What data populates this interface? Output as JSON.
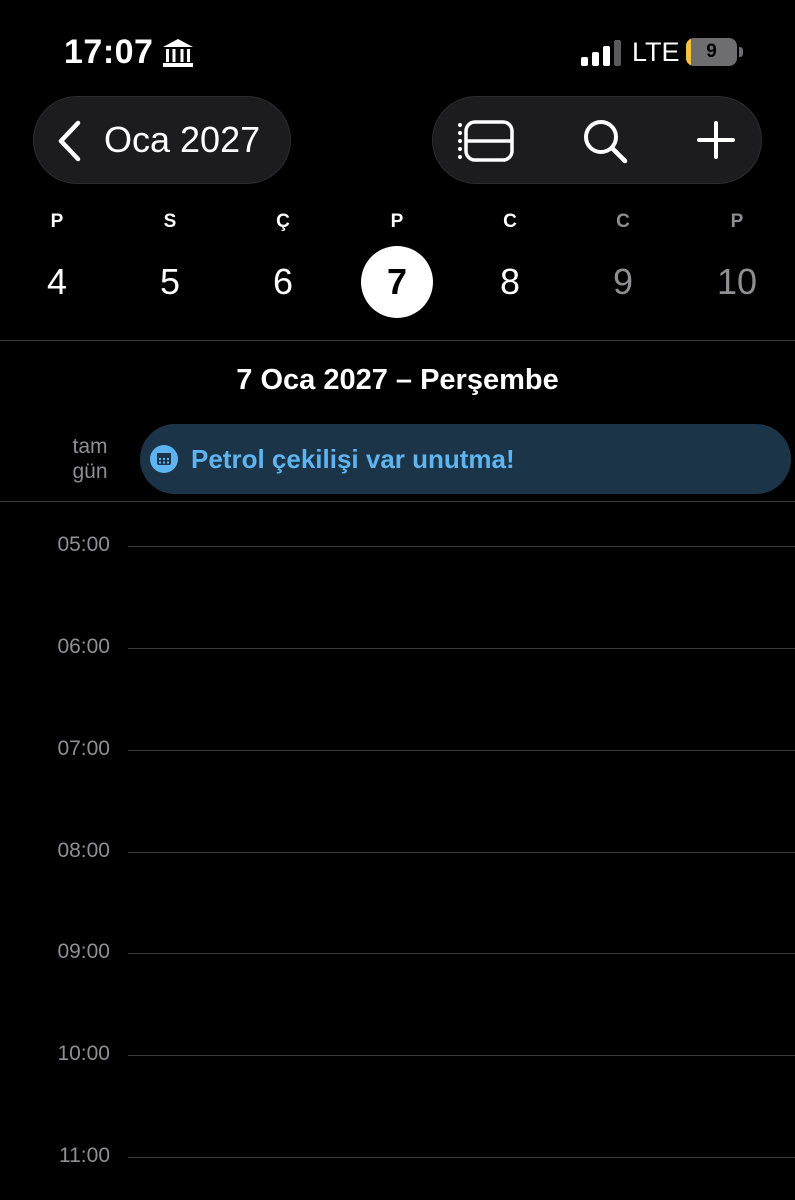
{
  "status_bar": {
    "time": "17:07",
    "network": "LTE",
    "battery_level": "9",
    "battery_fraction": 0.09,
    "signal_bars_active": 3,
    "icons": [
      "bank-icon",
      "cellular-signal-icon",
      "battery-icon"
    ]
  },
  "toolbar": {
    "back_label": "Oca 2027",
    "icons": [
      "chevron-left-icon",
      "list-view-icon",
      "search-icon",
      "add-icon"
    ]
  },
  "week": {
    "days": [
      {
        "weekday": "P",
        "number": "4",
        "selected": false,
        "dim": false
      },
      {
        "weekday": "S",
        "number": "5",
        "selected": false,
        "dim": false
      },
      {
        "weekday": "Ç",
        "number": "6",
        "selected": false,
        "dim": false
      },
      {
        "weekday": "P",
        "number": "7",
        "selected": true,
        "dim": false
      },
      {
        "weekday": "C",
        "number": "8",
        "selected": false,
        "dim": false
      },
      {
        "weekday": "C",
        "number": "9",
        "selected": false,
        "dim": true
      },
      {
        "weekday": "P",
        "number": "10",
        "selected": false,
        "dim": true
      }
    ]
  },
  "day_view": {
    "date_heading": "7 Oca 2027 – Perşembe",
    "all_day_label_line1": "tam",
    "all_day_label_line2": "gün",
    "all_day_event": {
      "title": "Petrol çekilişi var unutma!",
      "icon": "calendar-icon"
    },
    "hours": [
      "05:00",
      "06:00",
      "07:00",
      "08:00",
      "09:00",
      "10:00",
      "11:00"
    ]
  },
  "colors": {
    "background": "#000000",
    "pill": "#1c1c1e",
    "event_background": "#1b3447",
    "event_text": "#5eb4f0",
    "secondary_text": "#8e8e93",
    "battery_fill": "#f3c43b"
  }
}
